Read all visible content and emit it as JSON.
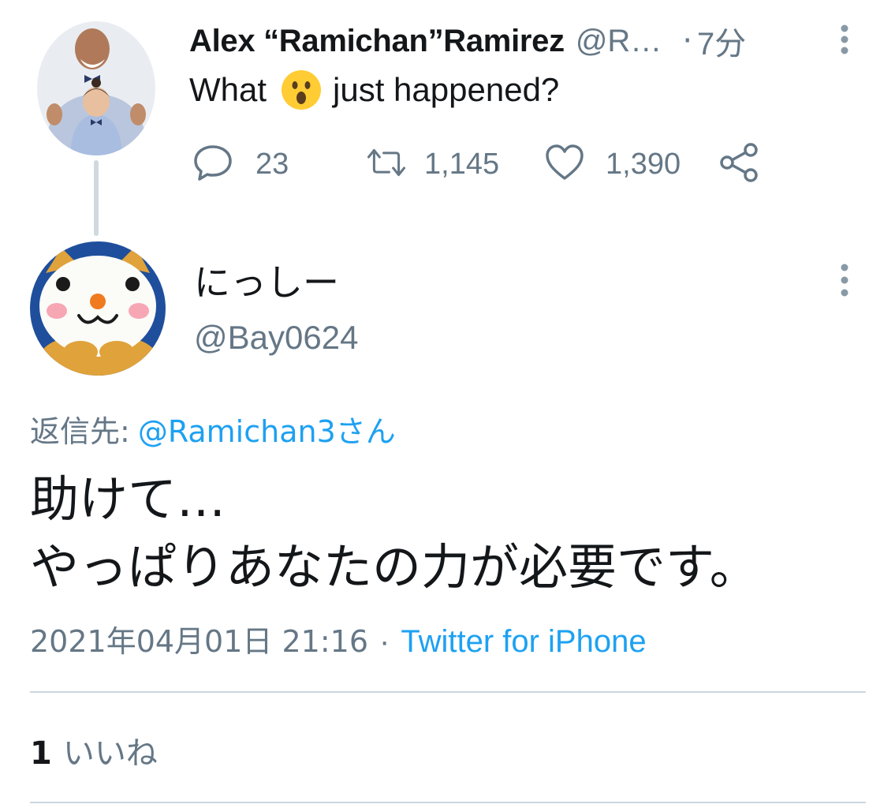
{
  "parent_tweet": {
    "name": "Alex “Ramichan”Ramirez",
    "handle": "@R…",
    "dot": "·",
    "time": "7分",
    "text_before": "What",
    "emoji": "hushed-face",
    "text_after": "just happened?",
    "reply_count": "23",
    "retweet_count": "1,145",
    "like_count": "1,390"
  },
  "main_tweet": {
    "name": "にっしー",
    "handle": "@Bay0624",
    "reply_label": "返信先:",
    "reply_mention": "@Ramichan3さん",
    "text_lines": [
      "助けて…",
      "やっぱりあなたの力が必要です。"
    ],
    "date": "2021年04月01日 21:16",
    "separator": "·",
    "client": "Twitter for iPhone",
    "likes_count": "1",
    "likes_label": "いいね"
  },
  "colors": {
    "text": "#14171a",
    "secondary": "#657786",
    "link": "#1da1f2",
    "divider": "#ccd6dd",
    "thread_line": "#cfd9de"
  },
  "icons": [
    "reply-icon",
    "retweet-icon",
    "like-icon",
    "share-icon",
    "more-options-icon",
    "hushed-face-emoji"
  ]
}
